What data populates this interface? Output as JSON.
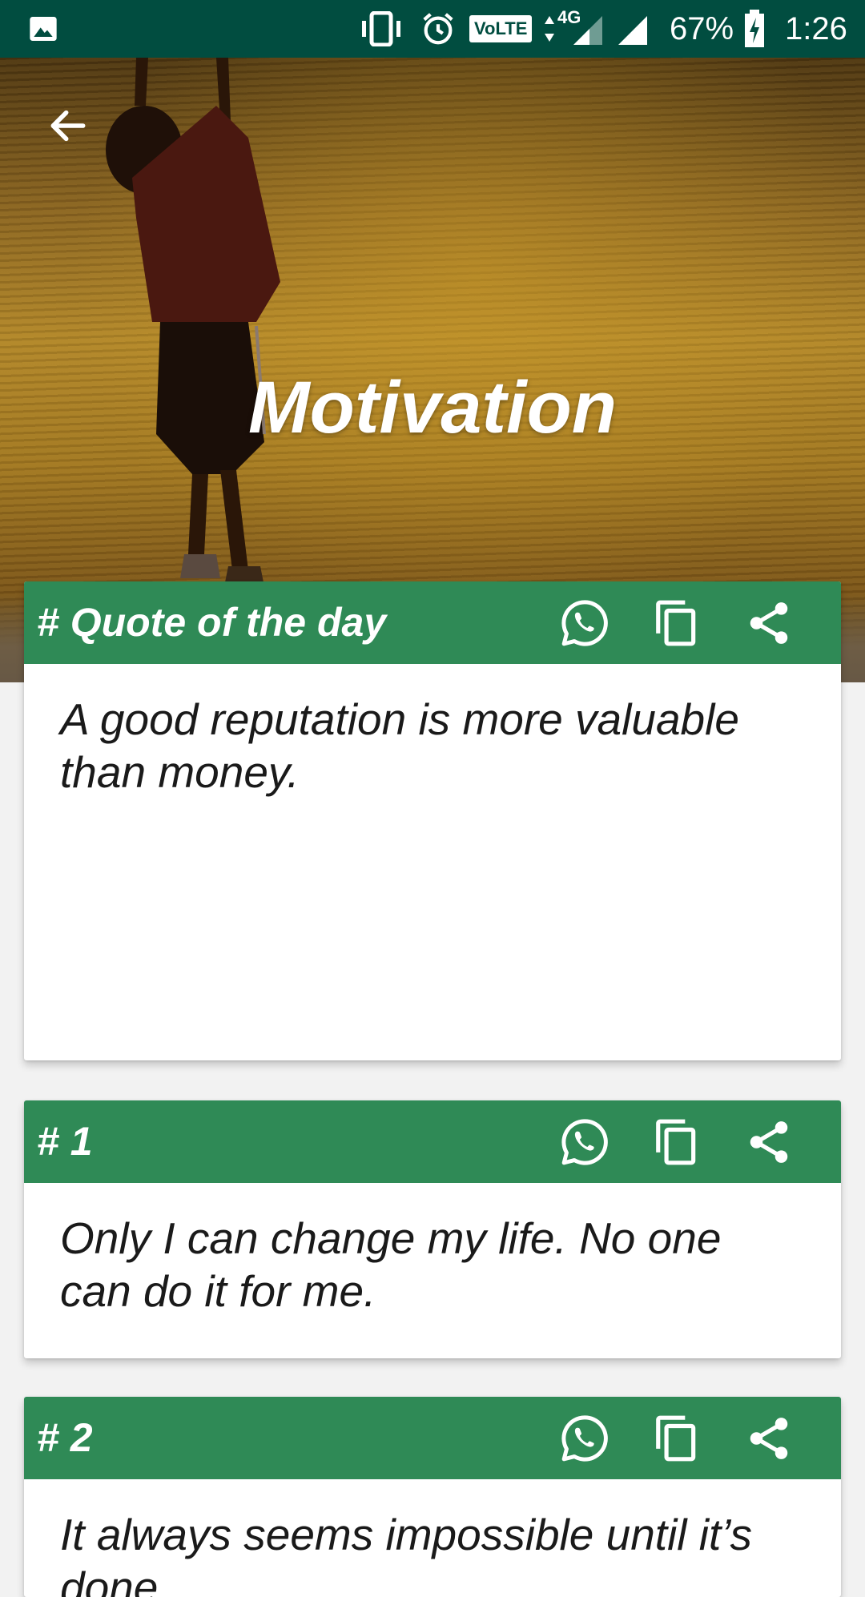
{
  "status_bar": {
    "volte_label": "VoLTE",
    "network_label": "4G",
    "battery_percent": "67%",
    "time": "1:26"
  },
  "header": {
    "title": "Motivation"
  },
  "cards": [
    {
      "title": "# Quote of the day",
      "text": "A good reputation is more valuable than money."
    },
    {
      "title": "# 1",
      "text": "Only I can change my life. No one can do it for me."
    },
    {
      "title": "# 2",
      "text": "It always seems impossible until it’s done."
    }
  ],
  "colors": {
    "status_bar": "#014d40",
    "card_header": "#2f8a56",
    "background": "#f2f2f2"
  },
  "icons": {
    "back": "arrow-left-icon",
    "whatsapp": "whatsapp-icon",
    "copy": "copy-icon",
    "share": "share-icon"
  }
}
